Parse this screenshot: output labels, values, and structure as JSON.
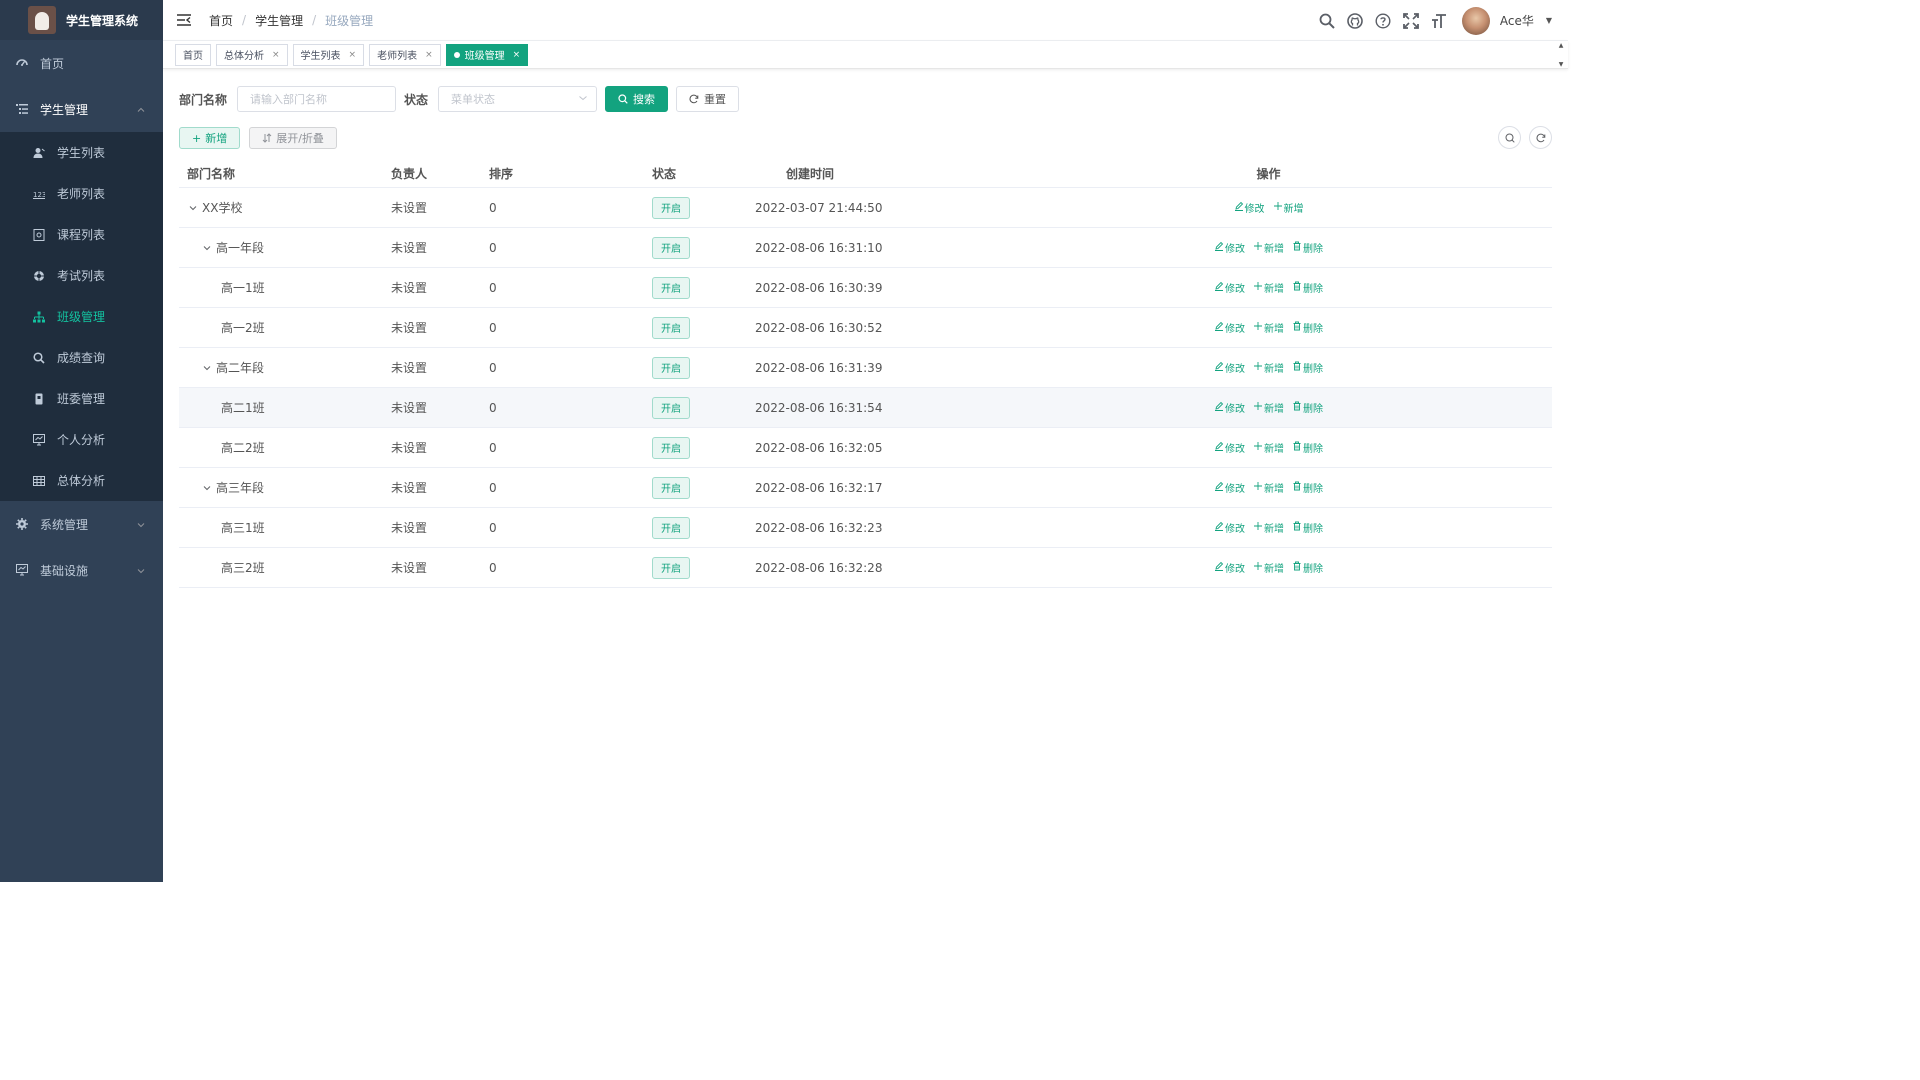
{
  "app": {
    "title": "学生管理系统"
  },
  "sidebar": {
    "items": [
      {
        "label": "首页"
      },
      {
        "label": "学生管理"
      },
      {
        "label": "系统管理"
      },
      {
        "label": "基础设施"
      }
    ],
    "sub": [
      {
        "label": "学生列表"
      },
      {
        "label": "老师列表"
      },
      {
        "label": "课程列表"
      },
      {
        "label": "考试列表"
      },
      {
        "label": "班级管理"
      },
      {
        "label": "成绩查询"
      },
      {
        "label": "班委管理"
      },
      {
        "label": "个人分析"
      },
      {
        "label": "总体分析"
      }
    ]
  },
  "breadcrumb": {
    "home": "首页",
    "parent": "学生管理",
    "current": "班级管理"
  },
  "user": {
    "name": "Ace华"
  },
  "tags": [
    {
      "label": "首页"
    },
    {
      "label": "总体分析"
    },
    {
      "label": "学生列表"
    },
    {
      "label": "老师列表"
    },
    {
      "label": "班级管理"
    }
  ],
  "search": {
    "dept_label": "部门名称",
    "dept_placeholder": "请输入部门名称",
    "status_label": "状态",
    "status_placeholder": "菜单状态",
    "search_btn": "搜索",
    "reset_btn": "重置"
  },
  "actions": {
    "add": "新增",
    "toggle": "展开/折叠"
  },
  "table": {
    "headers": {
      "name": "部门名称",
      "leader": "负责人",
      "sort": "排序",
      "status": "状态",
      "created": "创建时间",
      "ops": "操作"
    },
    "ops": {
      "edit": "修改",
      "add": "新增",
      "delete": "删除"
    },
    "rows": [
      {
        "name": "XX学校",
        "leader": "未设置",
        "sort": "0",
        "status": "开启",
        "created": "2022-03-07 21:44:50"
      },
      {
        "name": "高一年段",
        "leader": "未设置",
        "sort": "0",
        "status": "开启",
        "created": "2022-08-06 16:31:10"
      },
      {
        "name": "高一1班",
        "leader": "未设置",
        "sort": "0",
        "status": "开启",
        "created": "2022-08-06 16:30:39"
      },
      {
        "name": "高一2班",
        "leader": "未设置",
        "sort": "0",
        "status": "开启",
        "created": "2022-08-06 16:30:52"
      },
      {
        "name": "高二年段",
        "leader": "未设置",
        "sort": "0",
        "status": "开启",
        "created": "2022-08-06 16:31:39"
      },
      {
        "name": "高二1班",
        "leader": "未设置",
        "sort": "0",
        "status": "开启",
        "created": "2022-08-06 16:31:54"
      },
      {
        "name": "高二2班",
        "leader": "未设置",
        "sort": "0",
        "status": "开启",
        "created": "2022-08-06 16:32:05"
      },
      {
        "name": "高三年段",
        "leader": "未设置",
        "sort": "0",
        "status": "开启",
        "created": "2022-08-06 16:32:17"
      },
      {
        "name": "高三1班",
        "leader": "未设置",
        "sort": "0",
        "status": "开启",
        "created": "2022-08-06 16:32:23"
      },
      {
        "name": "高三2班",
        "leader": "未设置",
        "sort": "0",
        "status": "开启",
        "created": "2022-08-06 16:32:28"
      }
    ]
  },
  "colors": {
    "accent": "#13a37f",
    "sidebar_bg": "#304156",
    "submenu_bg": "#1f2d3d"
  }
}
